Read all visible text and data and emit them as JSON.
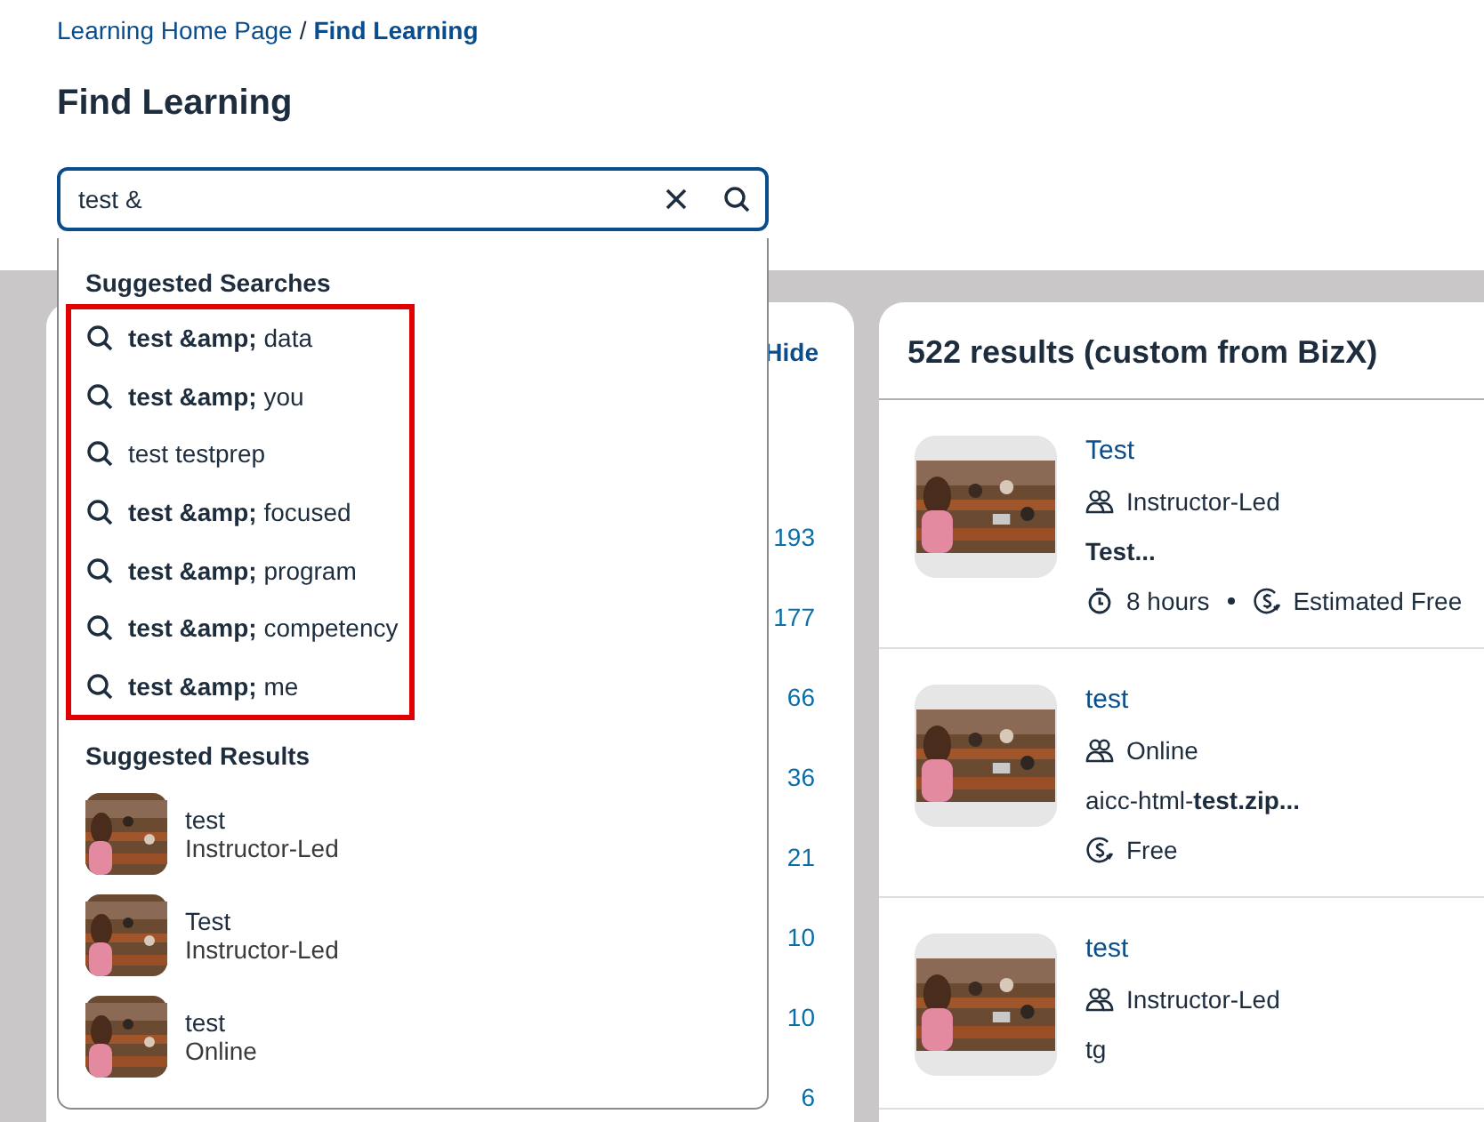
{
  "breadcrumb": {
    "home": "Learning Home Page",
    "separator": "/",
    "current": "Find Learning"
  },
  "title": "Find Learning",
  "search": {
    "value": "test &"
  },
  "suggestions": {
    "searches_title": "Suggested Searches",
    "searches": [
      "**test &amp;** data",
      "**test &amp;** you",
      "test testprep",
      "**test &amp;** focused",
      "**test &amp;** program",
      "**test &amp;** competency",
      "**test &amp;** me"
    ],
    "results_title": "Suggested Results",
    "results": [
      {
        "title": "test",
        "format": "Instructor-Led"
      },
      {
        "title": "Test",
        "format": "Instructor-Led"
      },
      {
        "title": "test",
        "format": "Online"
      }
    ]
  },
  "filters": {
    "hide": "Hide",
    "counts": [
      "193",
      "177",
      "66",
      "36",
      "21",
      "10",
      "10",
      "6"
    ]
  },
  "results": {
    "heading": "522 results (custom from BizX)",
    "items": [
      {
        "title": "Test",
        "type": "Instructor-Led",
        "description": "**Test...**",
        "meta": [
          {
            "kind": "duration",
            "text": "8 hours"
          },
          {
            "kind": "price",
            "text": "Estimated Free"
          }
        ]
      },
      {
        "title": "test",
        "type": "Online",
        "description": "aicc-html-**test.zip...**",
        "meta": [
          {
            "kind": "price",
            "text": "Free"
          }
        ]
      },
      {
        "title": "test",
        "type": "Instructor-Led",
        "description": "tg"
      }
    ]
  }
}
